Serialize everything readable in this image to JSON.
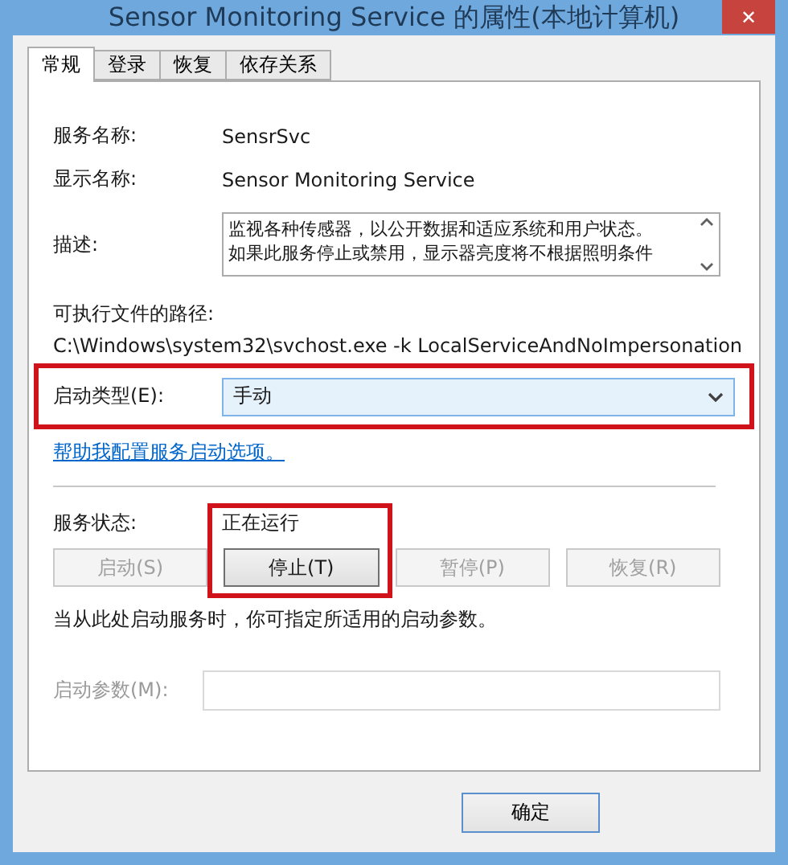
{
  "window": {
    "title": "Sensor Monitoring Service 的属性(本地计算机)",
    "close": "✕"
  },
  "tabs": [
    {
      "label": "常规",
      "selected": true
    },
    {
      "label": "登录",
      "selected": false
    },
    {
      "label": "恢复",
      "selected": false
    },
    {
      "label": "依存关系",
      "selected": false
    }
  ],
  "service_name": {
    "label": "服务名称:",
    "value": "SensrSvc"
  },
  "display_name": {
    "label": "显示名称:",
    "value": "Sensor Monitoring Service"
  },
  "description": {
    "label": "描述:",
    "lines": [
      "监视各种传感器，以公开数据和适应系统和用户状态。",
      "如果此服务停止或禁用，显示器亮度将不根据照明条件"
    ]
  },
  "executable_path": {
    "label": "可执行文件的路径:",
    "value": "C:\\Windows\\system32\\svchost.exe -k LocalServiceAndNoImpersonation"
  },
  "startup_type": {
    "label": "启动类型(E):",
    "value": "手动",
    "highlighted": true
  },
  "help_link": "帮助我配置服务启动选项。",
  "service_status": {
    "label": "服务状态:",
    "value": "正在运行"
  },
  "control_buttons": [
    {
      "label": "启动(S)",
      "disabled": true,
      "highlighted": false
    },
    {
      "label": "停止(T)",
      "disabled": false,
      "highlighted": true
    },
    {
      "label": "暂停(P)",
      "disabled": true,
      "highlighted": false
    },
    {
      "label": "恢复(R)",
      "disabled": true,
      "highlighted": false
    }
  ],
  "hint": "当从此处启动服务时，你可指定所适用的启动参数。",
  "start_parameters": {
    "label": "启动参数(M):",
    "disabled": true
  },
  "dialog_buttons": [
    "确定"
  ]
}
